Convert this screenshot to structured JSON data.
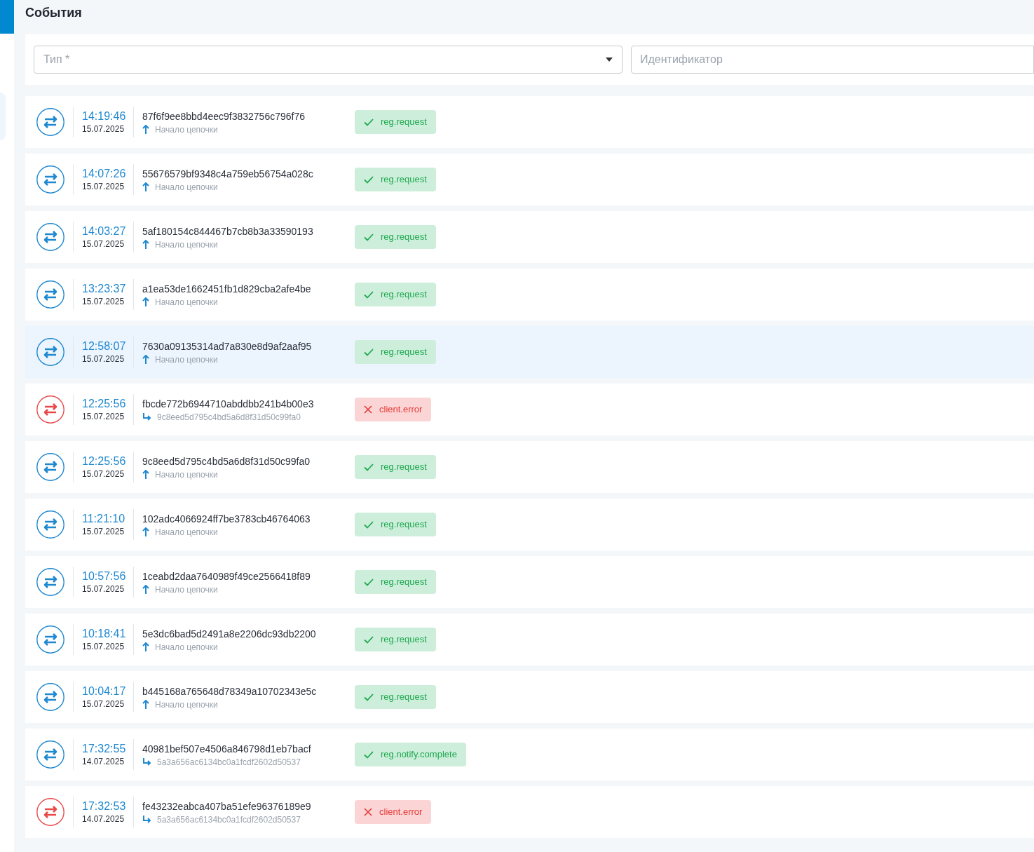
{
  "page": {
    "title": "События"
  },
  "filters": {
    "type_field": {
      "placeholder": "Тип *"
    },
    "id_field": {
      "placeholder": "Идентификатор"
    }
  },
  "events": [
    {
      "error": false,
      "time": "14:19:46",
      "date": "15.07.2025",
      "id": "87f6f9ee8bbd4eec9f3832756c796f76",
      "kind": "start",
      "chain": "Начало цепочки",
      "tag": "reg.request",
      "selected": false
    },
    {
      "error": false,
      "time": "14:07:26",
      "date": "15.07.2025",
      "id": "55676579bf9348c4a759eb56754a028c",
      "kind": "start",
      "chain": "Начало цепочки",
      "tag": "reg.request",
      "selected": false
    },
    {
      "error": false,
      "time": "14:03:27",
      "date": "15.07.2025",
      "id": "5af180154c844467b7cb8b3a33590193",
      "kind": "start",
      "chain": "Начало цепочки",
      "tag": "reg.request",
      "selected": false
    },
    {
      "error": false,
      "time": "13:23:37",
      "date": "15.07.2025",
      "id": "a1ea53de1662451fb1d829cba2afe4be",
      "kind": "start",
      "chain": "Начало цепочки",
      "tag": "reg.request",
      "selected": false
    },
    {
      "error": false,
      "time": "12:58:07",
      "date": "15.07.2025",
      "id": "7630a09135314ad7a830e8d9af2aaf95",
      "kind": "start",
      "chain": "Начало цепочки",
      "tag": "reg.request",
      "selected": true
    },
    {
      "error": true,
      "time": "12:25:56",
      "date": "15.07.2025",
      "id": "fbcde772b6944710abddbb241b4b00e3",
      "kind": "child",
      "chain": "9c8eed5d795c4bd5a6d8f31d50c99fa0",
      "tag": "client.error",
      "selected": false
    },
    {
      "error": false,
      "time": "12:25:56",
      "date": "15.07.2025",
      "id": "9c8eed5d795c4bd5a6d8f31d50c99fa0",
      "kind": "start",
      "chain": "Начало цепочки",
      "tag": "reg.request",
      "selected": false
    },
    {
      "error": false,
      "time": "11:21:10",
      "date": "15.07.2025",
      "id": "102adc4066924ff7be3783cb46764063",
      "kind": "start",
      "chain": "Начало цепочки",
      "tag": "reg.request",
      "selected": false
    },
    {
      "error": false,
      "time": "10:57:56",
      "date": "15.07.2025",
      "id": "1ceabd2daa7640989f49ce2566418f89",
      "kind": "start",
      "chain": "Начало цепочки",
      "tag": "reg.request",
      "selected": false
    },
    {
      "error": false,
      "time": "10:18:41",
      "date": "15.07.2025",
      "id": "5e3dc6bad5d2491a8e2206dc93db2200",
      "kind": "start",
      "chain": "Начало цепочки",
      "tag": "reg.request",
      "selected": false
    },
    {
      "error": false,
      "time": "10:04:17",
      "date": "15.07.2025",
      "id": "b445168a765648d78349a10702343e5c",
      "kind": "start",
      "chain": "Начало цепочки",
      "tag": "reg.request",
      "selected": false
    },
    {
      "error": false,
      "time": "17:32:55",
      "date": "14.07.2025",
      "id": "40981bef507e4506a846798d1eb7bacf",
      "kind": "child",
      "chain": "5a3a656ac6134bc0a1fcdf2602d50537",
      "tag": "reg.notify.complete",
      "selected": false
    },
    {
      "error": true,
      "time": "17:32:53",
      "date": "14.07.2025",
      "id": "fe43232eabca407ba51efe96376189e9",
      "kind": "child",
      "chain": "5a3a656ac6134bc0a1fcdf2602d50537",
      "tag": "client.error",
      "selected": false
    }
  ]
}
